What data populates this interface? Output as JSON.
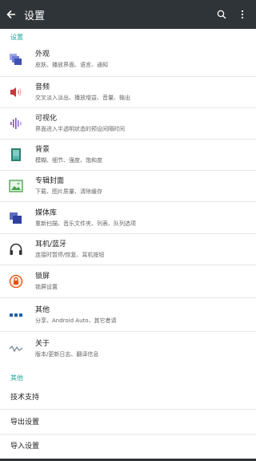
{
  "header": {
    "title": "设置"
  },
  "section_main": "设置",
  "items": [
    {
      "title": "外观",
      "subtitle": "皮肤、播放界面、语言、通知",
      "icon": "appearance-icon"
    },
    {
      "title": "音频",
      "subtitle": "交叉淡入淡出、播放增益、音量、输出",
      "icon": "audio-icon"
    },
    {
      "title": "可视化",
      "subtitle": "界面进入半透明状态的预设间隔时间",
      "icon": "visualization-icon"
    },
    {
      "title": "背景",
      "subtitle": "模糊、细节、强度、饱和度",
      "icon": "background-icon"
    },
    {
      "title": "专辑封面",
      "subtitle": "下载、图片质量、清除缓存",
      "icon": "album-cover-icon"
    },
    {
      "title": "媒体库",
      "subtitle": "重新扫描、音乐文件夹、列表、队列选项",
      "icon": "media-library-icon"
    },
    {
      "title": "耳机/蓝牙",
      "subtitle": "连接时暂停/恢复、耳机按钮",
      "icon": "headphones-icon"
    },
    {
      "title": "锁屏",
      "subtitle": "锁屏设置",
      "icon": "lock-screen-icon"
    },
    {
      "title": "其他",
      "subtitle": "分享、Android Auto、其它者请",
      "icon": "more-icon"
    },
    {
      "title": "关于",
      "subtitle": "版本/更新日志、翻译信息",
      "icon": "about-icon"
    }
  ],
  "section_other": "其他",
  "other_items": [
    "技术支持",
    "导出设置",
    "导入设置"
  ],
  "colors": {
    "topbar": "#2f3438",
    "accent": "#1fa89a"
  }
}
